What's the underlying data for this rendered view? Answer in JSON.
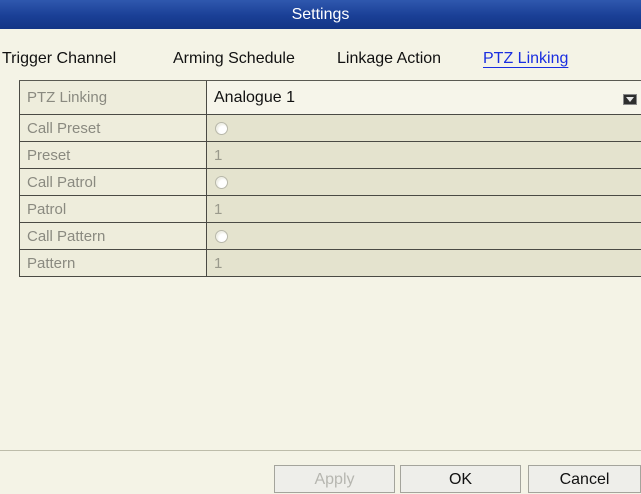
{
  "window": {
    "title": "Settings"
  },
  "tabs": [
    {
      "label": "Trigger Channel",
      "active": false
    },
    {
      "label": "Arming Schedule",
      "active": false
    },
    {
      "label": "Linkage Action",
      "active": false
    },
    {
      "label": "PTZ Linking",
      "active": true
    }
  ],
  "form": {
    "ptz_linking": {
      "label": "PTZ Linking",
      "value": "Analogue 1"
    },
    "call_preset": {
      "label": "Call Preset",
      "checked": false
    },
    "preset": {
      "label": "Preset",
      "value": "1"
    },
    "call_patrol": {
      "label": "Call Patrol",
      "checked": false
    },
    "patrol": {
      "label": "Patrol",
      "value": "1"
    },
    "call_pattern": {
      "label": "Call Pattern",
      "checked": false
    },
    "pattern": {
      "label": "Pattern",
      "value": "1"
    }
  },
  "buttons": {
    "apply": {
      "label": "Apply",
      "enabled": false
    },
    "ok": {
      "label": "OK"
    },
    "cancel": {
      "label": "Cancel"
    }
  },
  "colors": {
    "title_bar": "#1a3f96",
    "active_tab": "#1a2ee0",
    "background": "#f4f3e6"
  }
}
